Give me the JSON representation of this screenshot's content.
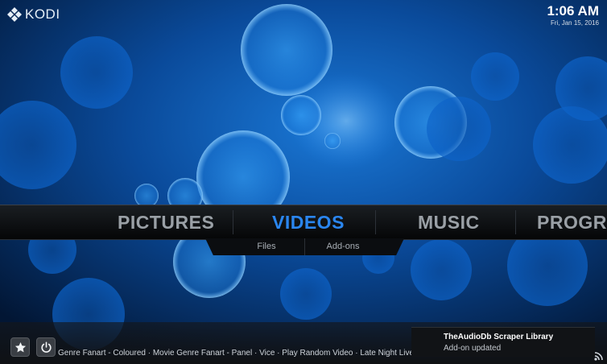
{
  "app": {
    "logo_text": "KODI"
  },
  "clock": {
    "time": "1:06 AM",
    "date": "Fri, Jan 15, 2016"
  },
  "main_menu": {
    "items": [
      {
        "label": "PICTURES",
        "active": false
      },
      {
        "label": "VIDEOS",
        "active": true
      },
      {
        "label": "MUSIC",
        "active": false
      },
      {
        "label": "PROGRA",
        "active": false
      }
    ],
    "submenu": [
      "Files",
      "Add-ons"
    ]
  },
  "bottom": {
    "favourites_icon": "star-icon",
    "power_icon": "power-icon",
    "ticker_text": "Genre Fanart - Coloured · Movie Genre Fanart - Panel · Vice · Play Random Video · Late Night Live · Play Random Videos · Revolve"
  },
  "notification": {
    "title": "TheAudioDb Scraper Library",
    "message": "Add-on updated"
  },
  "colors": {
    "accent": "#2a86f0",
    "background": "#031a3c"
  }
}
